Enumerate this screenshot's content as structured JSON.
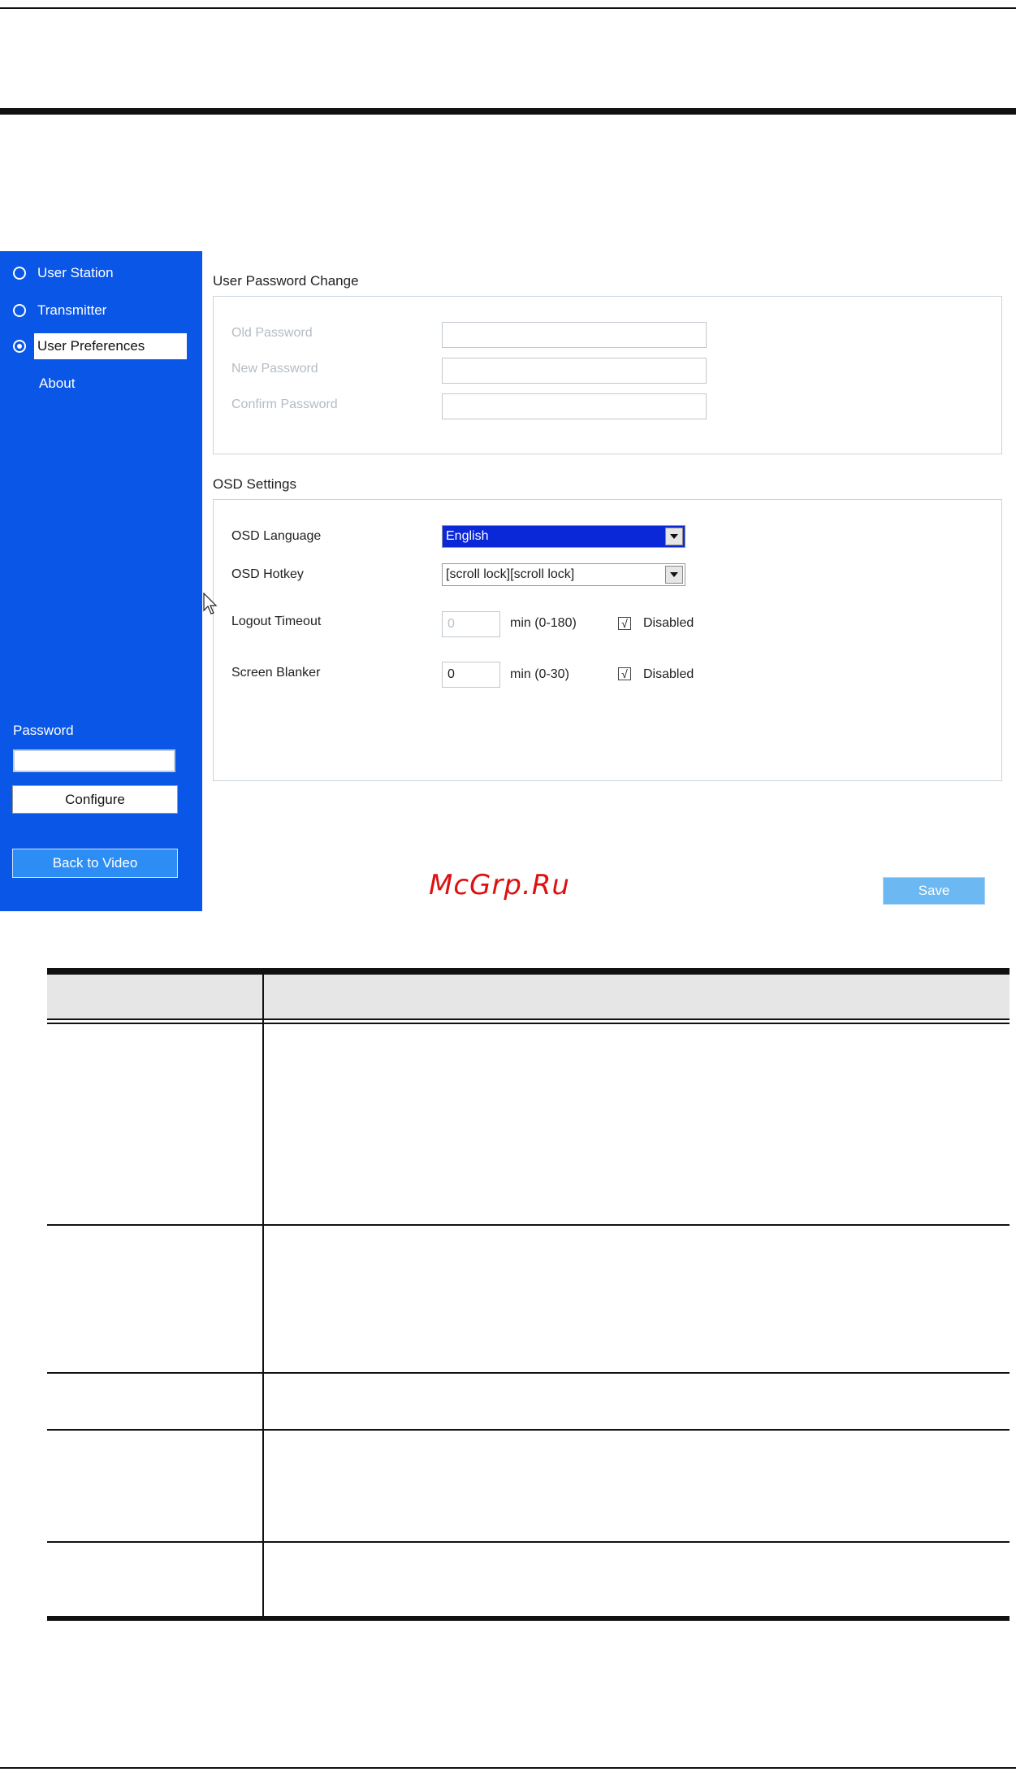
{
  "sidebar": {
    "items": [
      {
        "label": "User Station",
        "radio": true,
        "checked": false
      },
      {
        "label": "Transmitter",
        "radio": true,
        "checked": false
      },
      {
        "label": "User Preferences",
        "radio": true,
        "checked": true
      },
      {
        "label": "About",
        "radio": false,
        "checked": false
      }
    ],
    "password_label": "Password",
    "configure_label": "Configure",
    "back_label": "Back to Video"
  },
  "password_change": {
    "title": "User Password Change",
    "old_label": "Old Password",
    "new_label": "New Password",
    "confirm_label": "Confirm Password"
  },
  "osd": {
    "title": "OSD Settings",
    "language_label": "OSD Language",
    "language_value": "English",
    "hotkey_label": "OSD Hotkey",
    "hotkey_value": "[scroll lock][scroll lock]",
    "logout_label": "Logout Timeout",
    "logout_value": "0",
    "logout_unit": "min (0-180)",
    "logout_disabled_label": "Disabled",
    "blanker_label": "Screen Blanker",
    "blanker_value": "0",
    "blanker_unit": "min (0-30)",
    "blanker_disabled_label": "Disabled",
    "check_glyph": "√"
  },
  "save_label": "Save",
  "watermark": "McGrp.Ru",
  "colors": {
    "sidebar_bg": "#0a56e6",
    "select_highlight": "#0a28d8",
    "save_bg": "#6cb8f2",
    "watermark": "#dd1111"
  }
}
